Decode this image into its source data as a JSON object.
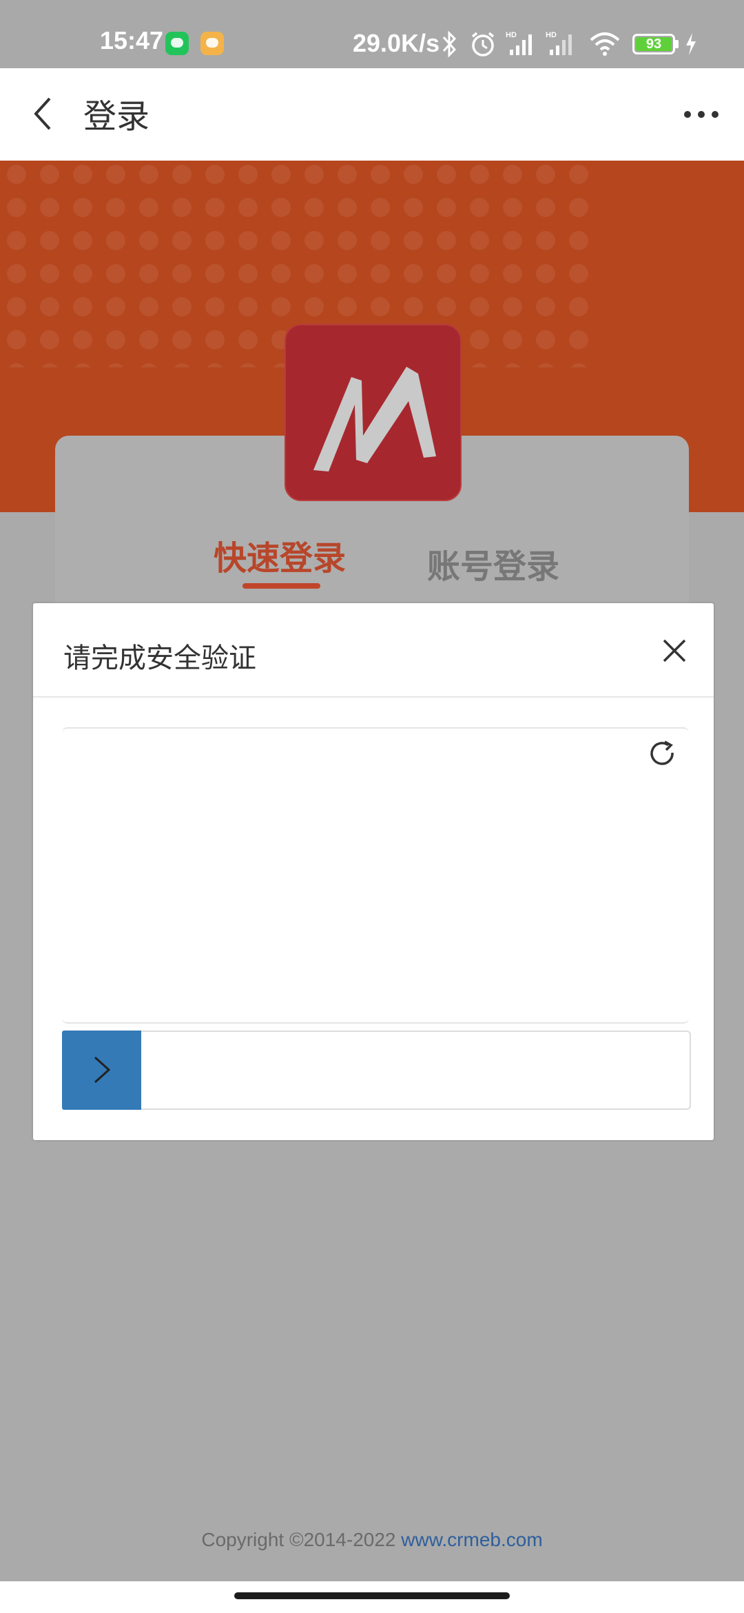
{
  "status_bar": {
    "time": "15:47",
    "net_speed": "29.0K/s",
    "battery": "93",
    "icons": [
      "wechat-icon",
      "message-icon",
      "bluetooth-icon",
      "alarm-icon",
      "signal-hd-icon",
      "signal-hd-icon",
      "wifi-icon",
      "battery-icon",
      "charging-icon"
    ]
  },
  "nav": {
    "title": "登录",
    "icons": [
      "back-arrow-icon",
      "more-icon"
    ]
  },
  "login": {
    "tabs": [
      {
        "label": "快速登录",
        "active": true
      },
      {
        "label": "账号登录",
        "active": false
      }
    ],
    "logo_icon": "m-logo",
    "colors": {
      "brand": "#c0452a",
      "logo_bg": "#a6282e"
    }
  },
  "verify_modal": {
    "title": "请完成安全验证",
    "icons": [
      "close-icon",
      "refresh-icon",
      "chevron-right-icon"
    ],
    "slider_color": "#337ab7"
  },
  "footer": {
    "copyright_text": "Copyright ©2014-2022",
    "link_text": "www.crmeb.com"
  }
}
